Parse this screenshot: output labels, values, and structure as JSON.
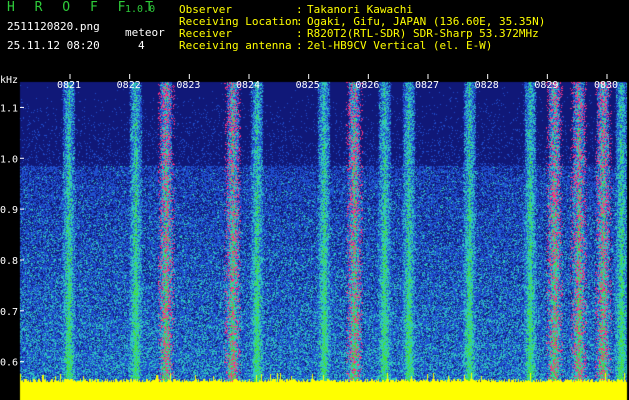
{
  "header": {
    "app_title": "HROFFT",
    "app_version": "1.0.0",
    "file_name": "2511120820.png",
    "timestamp": "25.11.12 08:20",
    "meteor_label": "meteor",
    "meteor_count": "4"
  },
  "station": [
    {
      "key": "Observer",
      "value": "Takanori Kawachi"
    },
    {
      "key": "Receiving Location",
      "value": "Ogaki, Gifu, JAPAN (136.60E, 35.35N)"
    },
    {
      "key": "Receiver",
      "value": "R820T2(RTL-SDR) SDR-Sharp 53.372MHz"
    },
    {
      "key": "Receiving antenna",
      "value": "2el-HB9CV Vertical (el. E-W)"
    }
  ],
  "spectrogram": {
    "y_unit": "kHz",
    "y_ticks": [
      "1.1",
      "1.0",
      "0.9",
      "0.8",
      "0.7",
      "0.6"
    ],
    "y_tick_values": [
      1.1,
      1.0,
      0.9,
      0.8,
      0.7,
      0.6
    ],
    "y_range": [
      0.56,
      1.15
    ],
    "x_ticks": [
      "0821",
      "0822",
      "0823",
      "0824",
      "0825",
      "0826",
      "0827",
      "0828",
      "0829",
      "0830"
    ],
    "colors": {
      "background": "#101878",
      "low": "#2050d0",
      "mid": "#30c8c0",
      "high": "#40e040",
      "peak": "#ff3080",
      "floor": "#ffff00",
      "tick_label": "#ffffff",
      "axis_unit": "#ffffff"
    }
  }
}
